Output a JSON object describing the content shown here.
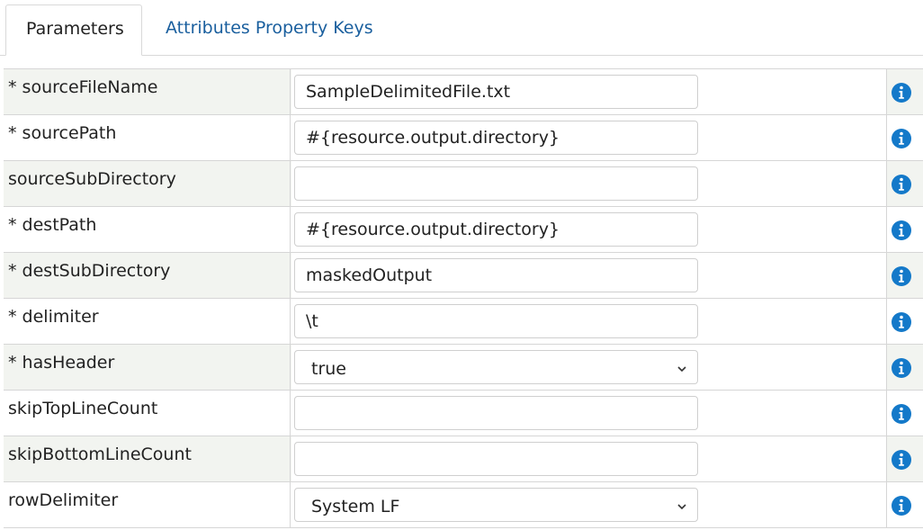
{
  "tabs": [
    {
      "label": "Parameters",
      "active": true
    },
    {
      "label": "Attributes Property Keys",
      "active": false
    }
  ],
  "parameters": [
    {
      "label": "* sourceFileName",
      "type": "text",
      "value": "SampleDelimitedFile.txt"
    },
    {
      "label": "* sourcePath",
      "type": "text",
      "value": "#{resource.output.directory}"
    },
    {
      "label": "sourceSubDirectory",
      "type": "text",
      "value": ""
    },
    {
      "label": "* destPath",
      "type": "text",
      "value": "#{resource.output.directory}"
    },
    {
      "label": "* destSubDirectory",
      "type": "text",
      "value": "maskedOutput"
    },
    {
      "label": "* delimiter",
      "type": "text",
      "value": "\\t"
    },
    {
      "label": "* hasHeader",
      "type": "select",
      "value": "true"
    },
    {
      "label": "skipTopLineCount",
      "type": "text",
      "value": ""
    },
    {
      "label": "skipBottomLineCount",
      "type": "text",
      "value": ""
    },
    {
      "label": "rowDelimiter",
      "type": "select",
      "value": "System LF"
    }
  ],
  "icons": {
    "info": "info-circle-icon",
    "chevron": "chevron-down-icon"
  },
  "colors": {
    "accent": "#1a5f9e",
    "info_icon": "#1479c9",
    "row_alt": "#f2f4f0"
  }
}
